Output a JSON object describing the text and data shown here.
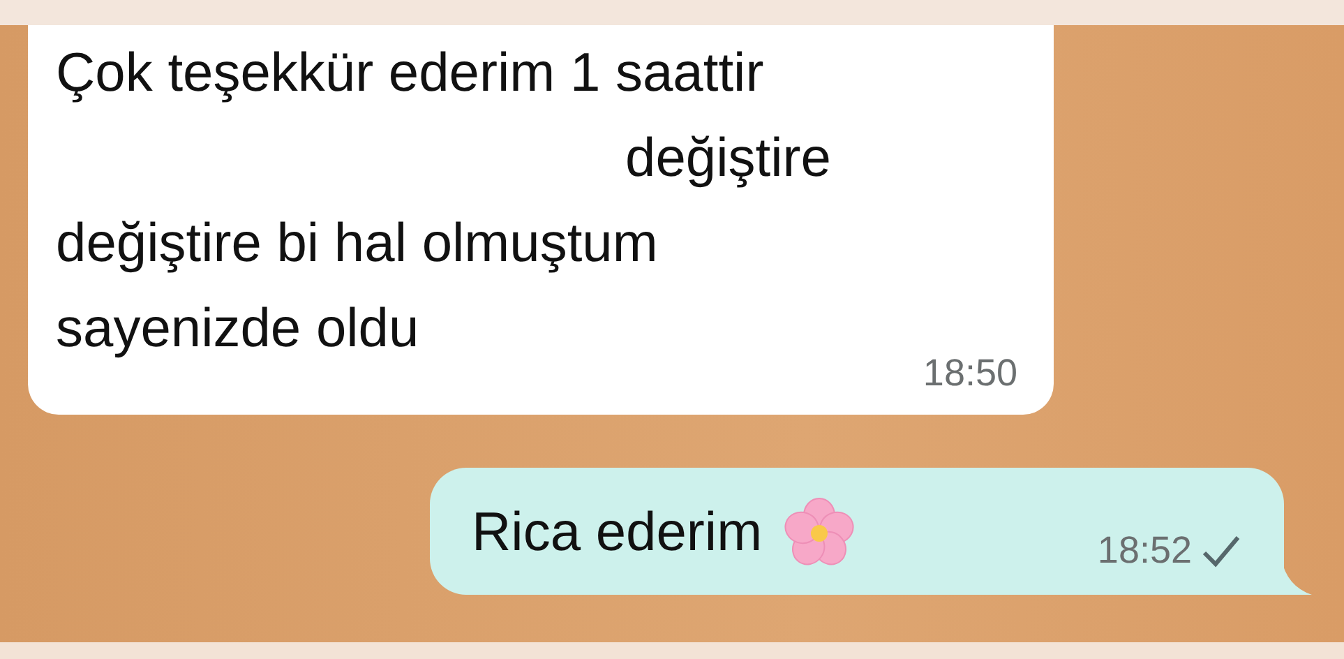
{
  "messages": [
    {
      "kind": "incoming",
      "lines": [
        {
          "kind": "plain",
          "text": "Çok teşekkür ederim 1 saattir"
        },
        {
          "kind": "indented",
          "text": "değiştire"
        },
        {
          "kind": "plain",
          "text": "değiştire bi hal olmuştum"
        },
        {
          "kind": "plain",
          "text": "sayenizde oldu"
        }
      ],
      "time": "18:50"
    },
    {
      "kind": "outgoing",
      "lines": [
        {
          "kind": "plain",
          "text": "Rica ederim"
        }
      ],
      "time": "18:52",
      "delivered": false
    }
  ]
}
